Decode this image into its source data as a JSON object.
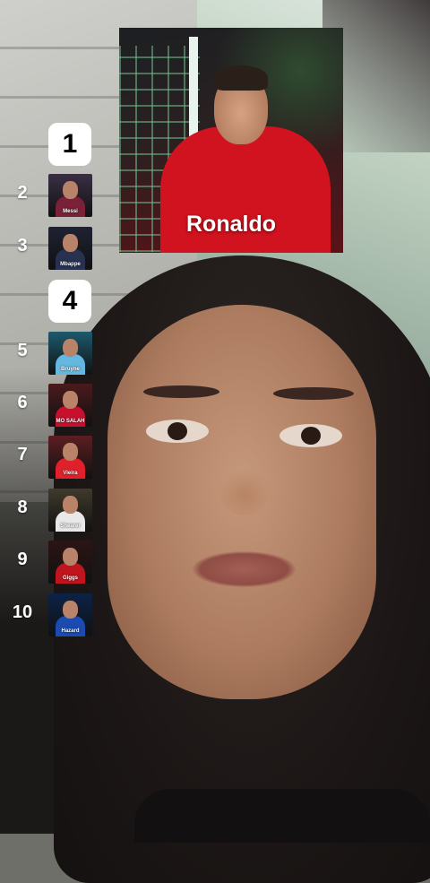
{
  "featured": {
    "name": "Ronaldo"
  },
  "ranking": [
    {
      "rank": "1",
      "type": "box",
      "box_label": "1"
    },
    {
      "rank": "2",
      "type": "thumb",
      "label": "Messi",
      "bg": "#3a2f44",
      "shirt": "#7a2037"
    },
    {
      "rank": "3",
      "type": "thumb",
      "label": "Mbappe",
      "bg": "#1f2233",
      "shirt": "#283250"
    },
    {
      "rank": "4",
      "type": "box",
      "box_label": "4"
    },
    {
      "rank": "5",
      "type": "thumb",
      "label": "Bruyne",
      "bg": "#1c5a6d",
      "shirt": "#64b8e0"
    },
    {
      "rank": "6",
      "type": "thumb",
      "label": "MO SALAH",
      "bg": "#4a1a1d",
      "shirt": "#c8102e"
    },
    {
      "rank": "7",
      "type": "thumb",
      "label": "Vieira",
      "bg": "#5c1e22",
      "shirt": "#e0202b"
    },
    {
      "rank": "8",
      "type": "thumb",
      "label": "Shearer",
      "bg": "#3f3a2c",
      "shirt": "#e8e8e8"
    },
    {
      "rank": "9",
      "type": "thumb",
      "label": "Giggs",
      "bg": "#2c1414",
      "shirt": "#c0141e"
    },
    {
      "rank": "10",
      "type": "thumb",
      "label": "Hazard",
      "bg": "#0c2247",
      "shirt": "#1b4bb0"
    }
  ]
}
